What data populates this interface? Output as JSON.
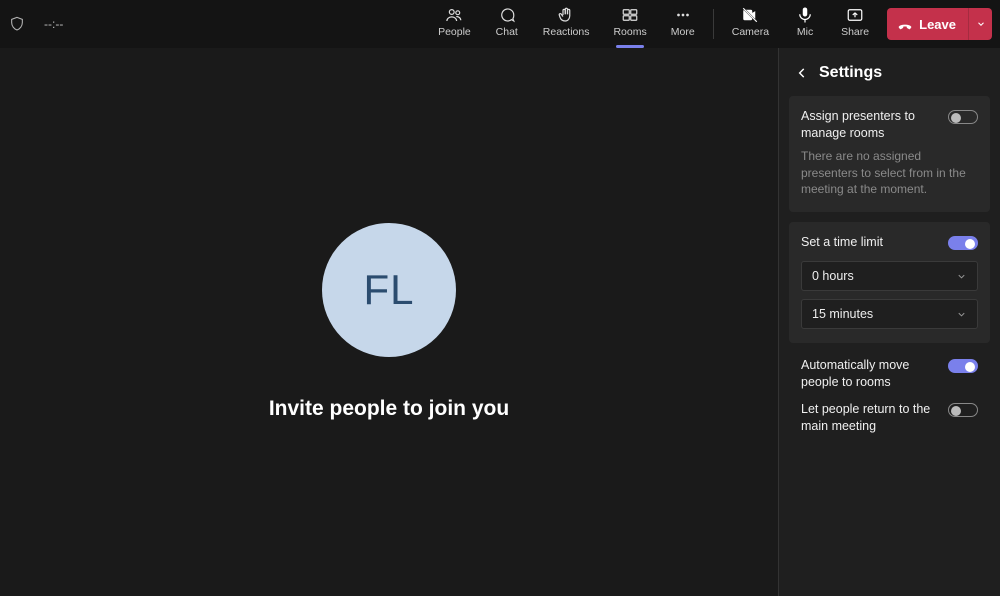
{
  "timer": "--:--",
  "tabs": {
    "people": "People",
    "chat": "Chat",
    "reactions": "Reactions",
    "rooms": "Rooms",
    "more": "More",
    "camera": "Camera",
    "mic": "Mic",
    "share": "Share"
  },
  "leave_label": "Leave",
  "avatar_initials": "FL",
  "invite_text": "Invite people to join you",
  "panel": {
    "title": "Settings",
    "assign": {
      "label": "Assign presenters to manage rooms",
      "sub": "There are no assigned presenters to select from in the meeting at the moment."
    },
    "timelimit": {
      "label": "Set a time limit",
      "hours": "0 hours",
      "minutes": "15 minutes"
    },
    "automove": "Automatically move people to rooms",
    "letreturn": "Let people return to the main meeting"
  }
}
